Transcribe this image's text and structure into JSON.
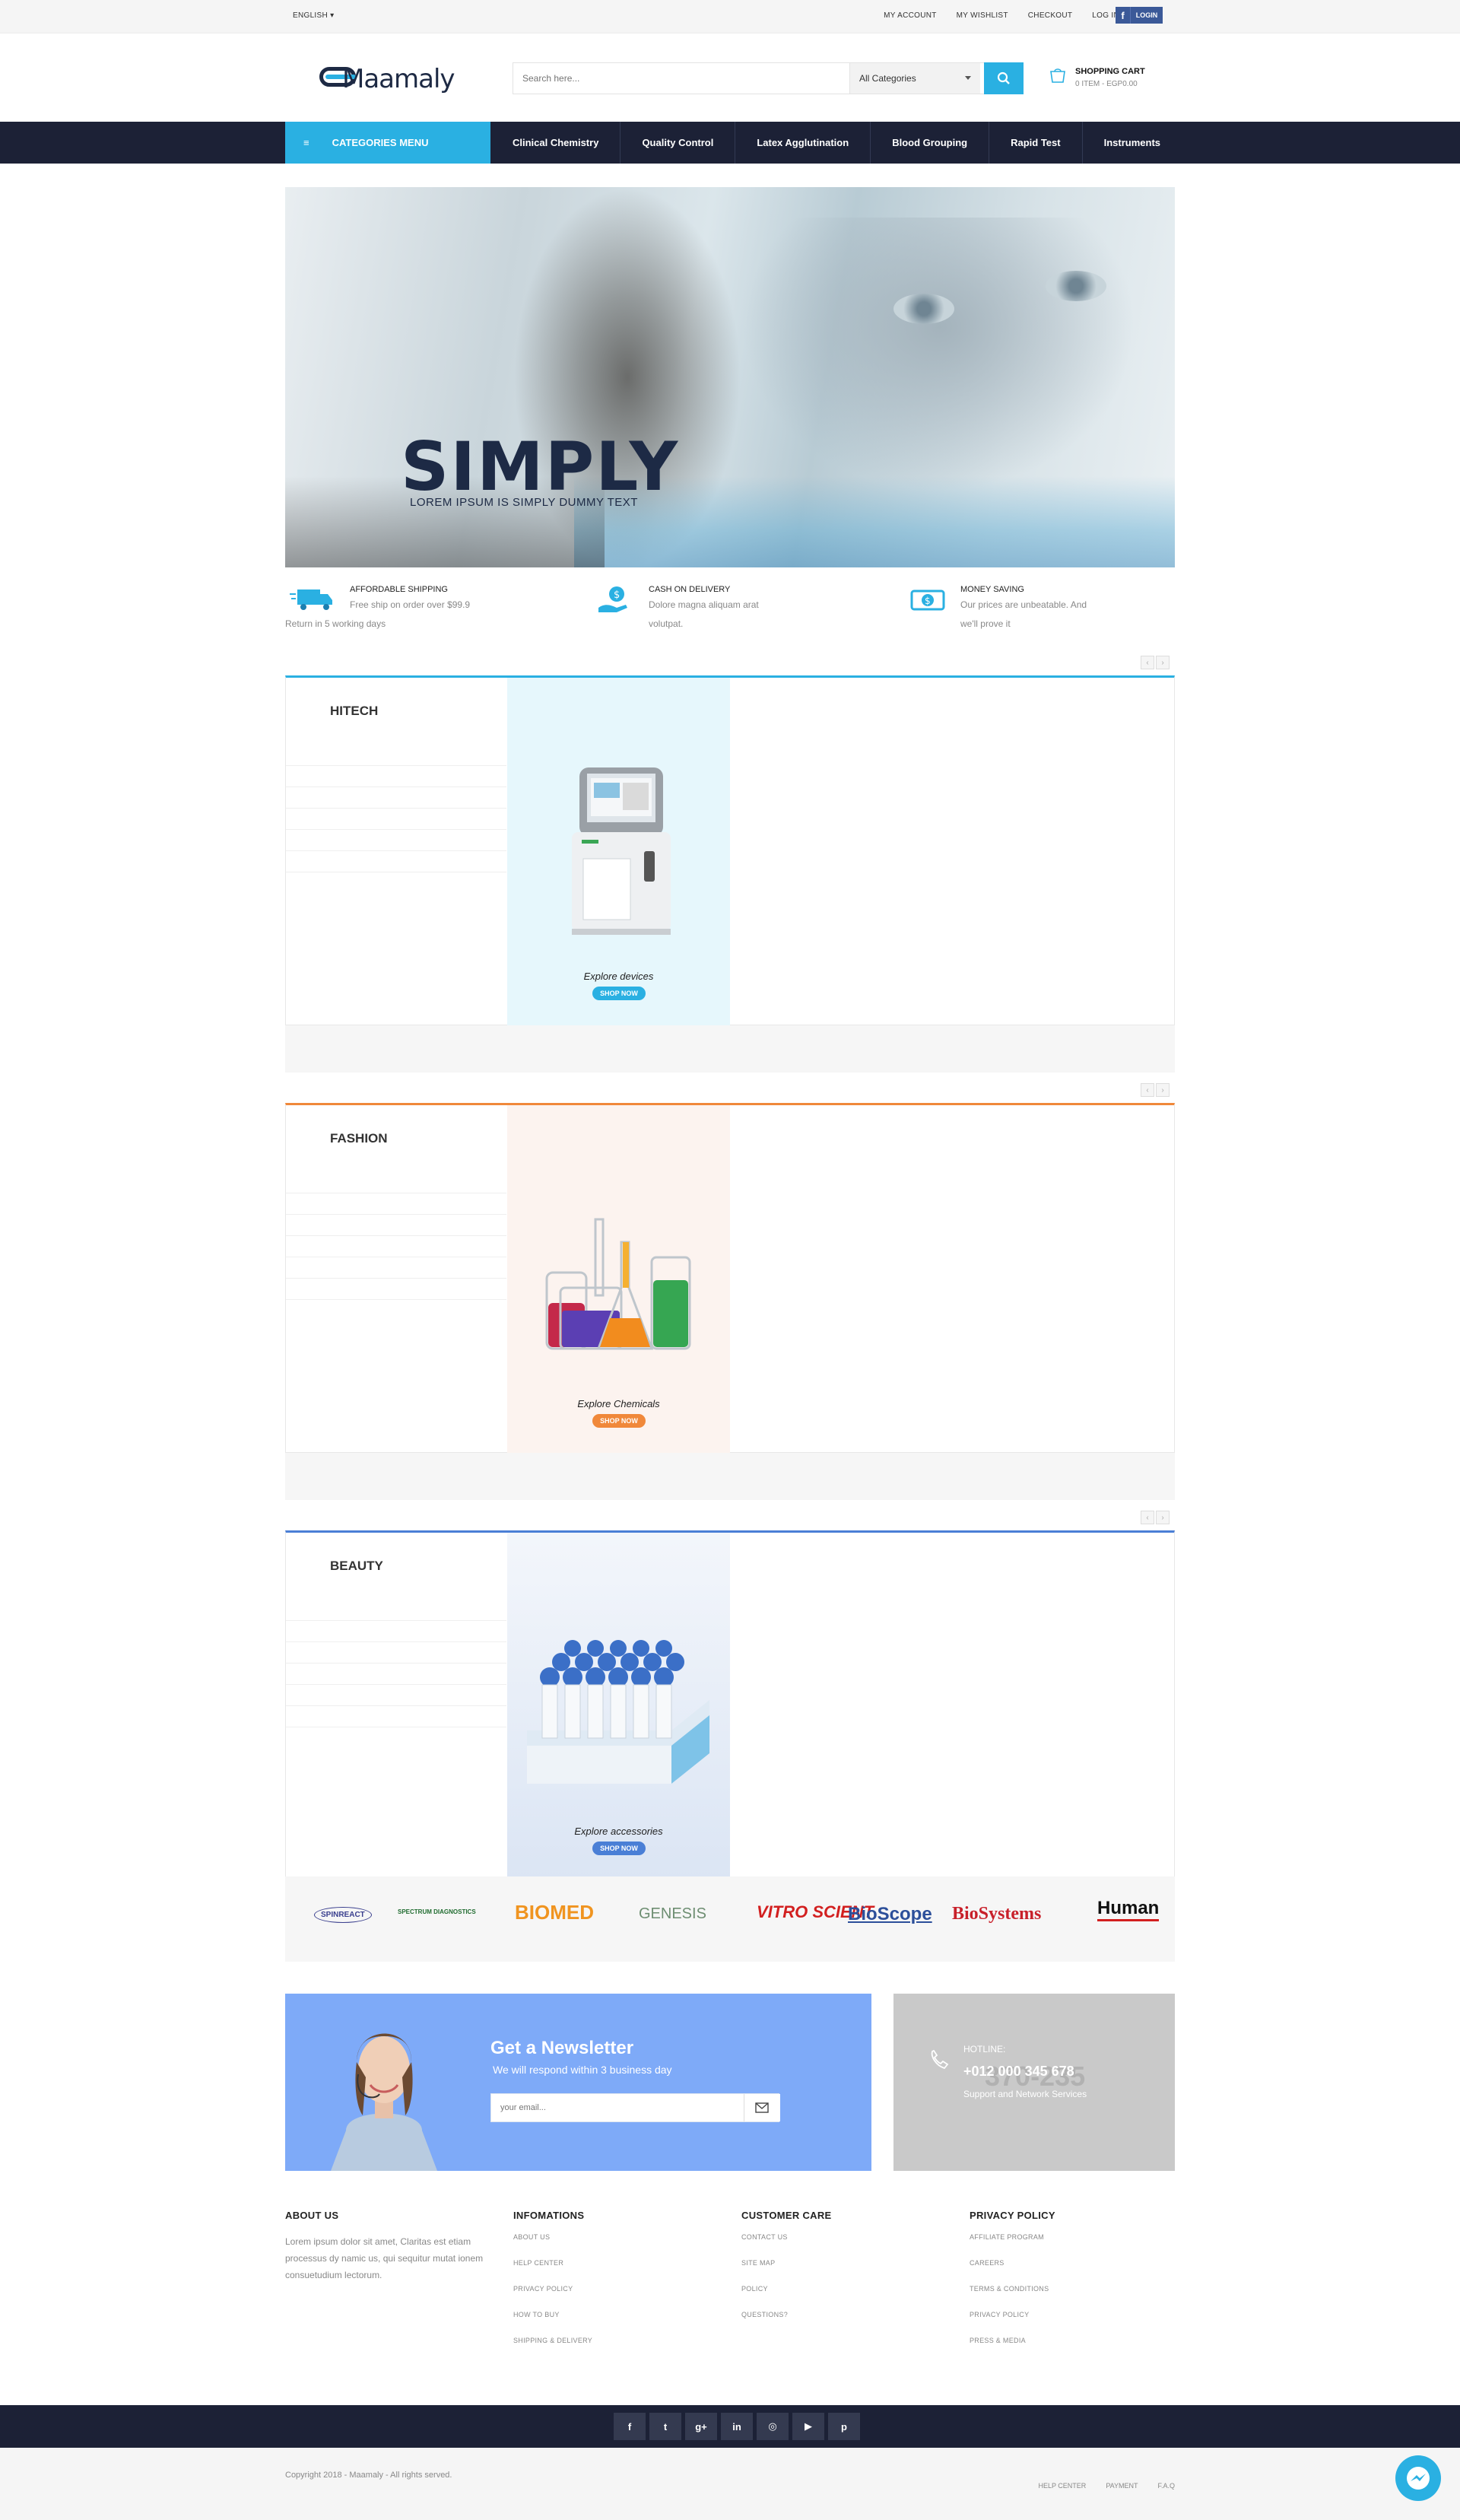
{
  "topbar": {
    "language": "ENGLISH",
    "links": [
      "MY ACCOUNT",
      "MY WISHLIST",
      "CHECKOUT",
      "LOG IN"
    ],
    "facebook_login": "LOGIN",
    "facebook_icon": "facebook-icon"
  },
  "header": {
    "logo_text": "Maamaly",
    "search_placeholder": "Search here...",
    "category_select": "All Categories",
    "search_icon": "search-icon",
    "cart_title": "SHOPPING CART",
    "cart_summary": "0 ITEM - EGP0.00",
    "cart_icon": "cart-icon"
  },
  "nav": {
    "categories_menu": "CATEGORIES MENU",
    "items": [
      "Clinical Chemistry",
      "Quality Control",
      "Latex Agglutination",
      "Blood Grouping",
      "Rapid Test",
      "Instruments"
    ]
  },
  "hero": {
    "headline": "SIMPLY",
    "subtitle": "LOREM IPSUM IS SIMPLY DUMMY TEXT"
  },
  "features": [
    {
      "title": "AFFORDABLE SHIPPING",
      "desc1": "Free ship on order over $99.9",
      "desc2": "Return in 5 working days",
      "icon": "truck-icon"
    },
    {
      "title": "CASH ON DELIVERY",
      "desc1": "Dolore magna aliquam arat",
      "desc2": "volutpat.",
      "icon": "hand-coin-icon"
    },
    {
      "title": "MONEY SAVING",
      "desc1": "Our prices are unbeatable. And",
      "desc2": "we'll prove it",
      "icon": "money-icon"
    }
  ],
  "sections": [
    {
      "title": "HITECH",
      "caption": "Explore devices",
      "shop": "SHOP NOW",
      "accent": "#2ab0e2",
      "banner_bg": "#e6f7fc"
    },
    {
      "title": "FASHION",
      "caption": "Explore Chemicals",
      "shop": "SHOP NOW",
      "accent": "#f0883a",
      "banner_bg": "#fcf3ef"
    },
    {
      "title": "BEAUTY",
      "caption": "Explore accessories",
      "shop": "SHOP NOW",
      "accent": "#4a7fd6",
      "banner_bg": "#e4ebf6"
    }
  ],
  "brands": [
    "SPINREACT",
    "SPECTRUM DIAGNOSTICS",
    "BIOMED",
    "GENESIS",
    "VITRO SCIENT",
    "BioScope",
    "BioSystems",
    "Human"
  ],
  "newsletter": {
    "title": "Get a Newsletter",
    "subtitle": "We will respond within 3 business day",
    "placeholder": "your email...",
    "send_icon": "envelope-icon"
  },
  "hotline": {
    "label": "HOTLINE:",
    "number": "+012 000 345 678",
    "service": "Support and Network Services",
    "watermark": "370-235",
    "icon": "phone-icon"
  },
  "footer": {
    "about": {
      "title": "ABOUT US",
      "text": "Lorem ipsum dolor sit amet, Claritas est etiam processus dy namic us, qui sequitur mutat ionem consuetudium lectorum."
    },
    "info": {
      "title": "INFOMATIONS",
      "links": [
        "ABOUT US",
        "HELP CENTER",
        "PRIVACY POLICY",
        "HOW TO BUY",
        "SHIPPING & DELIVERY"
      ]
    },
    "care": {
      "title": "CUSTOMER CARE",
      "links": [
        "CONTACT US",
        "SITE MAP",
        "POLICY",
        "QUESTIONS?"
      ]
    },
    "privacy": {
      "title": "PRIVACY POLICY",
      "links": [
        "AFFILIATE PROGRAM",
        "CAREERS",
        "TERMS & CONDITIONS",
        "PRIVACY POLICY",
        "PRESS & MEDIA"
      ]
    }
  },
  "social": [
    {
      "icon": "facebook-icon",
      "glyph": "f"
    },
    {
      "icon": "twitter-icon",
      "glyph": "t"
    },
    {
      "icon": "google-plus-icon",
      "glyph": "g+"
    },
    {
      "icon": "linkedin-icon",
      "glyph": "in"
    },
    {
      "icon": "instagram-icon",
      "glyph": "◎"
    },
    {
      "icon": "youtube-icon",
      "glyph": "▶"
    },
    {
      "icon": "pinterest-icon",
      "glyph": "p"
    }
  ],
  "bottom": {
    "copyright": "Copyright 2018 - Maamaly - All rights served.",
    "links": [
      "HELP CENTER",
      "PAYMENT",
      "F.A.Q"
    ],
    "messenger_icon": "messenger-icon"
  }
}
